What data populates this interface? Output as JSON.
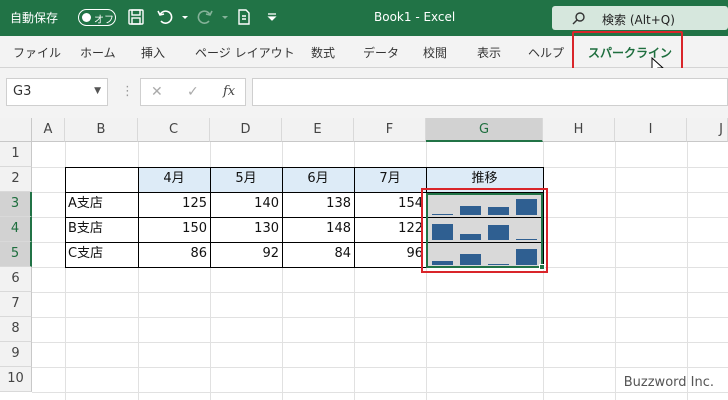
{
  "titlebar": {
    "autosave_label": "自動保存",
    "autosave_toggle": "オフ",
    "document_title": "Book1  -  Excel",
    "search_placeholder": "検索 (Alt+Q)",
    "icons": [
      "save-icon",
      "undo-icon",
      "redo-icon",
      "form-icon",
      "customize-icon",
      "search-icon"
    ]
  },
  "ribbon": {
    "tabs": [
      "ファイル",
      "ホーム",
      "挿入",
      "ページ レイアウト",
      "数式",
      "データ",
      "校閲",
      "表示",
      "ヘルプ",
      "スパークライン"
    ],
    "active_tab": "スパークライン",
    "highlight_color": "#d9252a"
  },
  "formula_bar": {
    "name_box": "G3",
    "cancel_symbol": "✕",
    "enter_symbol": "✓",
    "fx_label": "fx",
    "formula": ""
  },
  "sheet": {
    "columns": [
      "A",
      "B",
      "C",
      "D",
      "E",
      "F",
      "G",
      "H",
      "I",
      "J"
    ],
    "selected_column": "G",
    "rows": [
      "1",
      "2",
      "3",
      "4",
      "5",
      "6",
      "7",
      "8",
      "9",
      "10"
    ],
    "selected_rows": [
      "3",
      "4",
      "5"
    ],
    "table": {
      "headers": [
        "4月",
        "5月",
        "6月",
        "7月",
        "推移"
      ],
      "rows": [
        {
          "branch": "A支店",
          "values": [
            "125",
            "140",
            "138",
            "154"
          ],
          "sparkline": [
            125,
            140,
            138,
            154
          ]
        },
        {
          "branch": "B支店",
          "values": [
            "150",
            "130",
            "148",
            "122"
          ],
          "sparkline": [
            150,
            130,
            148,
            122
          ]
        },
        {
          "branch": "C支店",
          "values": [
            "86",
            "92",
            "84",
            "96"
          ],
          "sparkline": [
            86,
            92,
            84,
            96
          ]
        }
      ]
    },
    "sparkline_color": "#2f5f91",
    "accent_color": "#217346"
  },
  "watermark": "Buzzword Inc."
}
